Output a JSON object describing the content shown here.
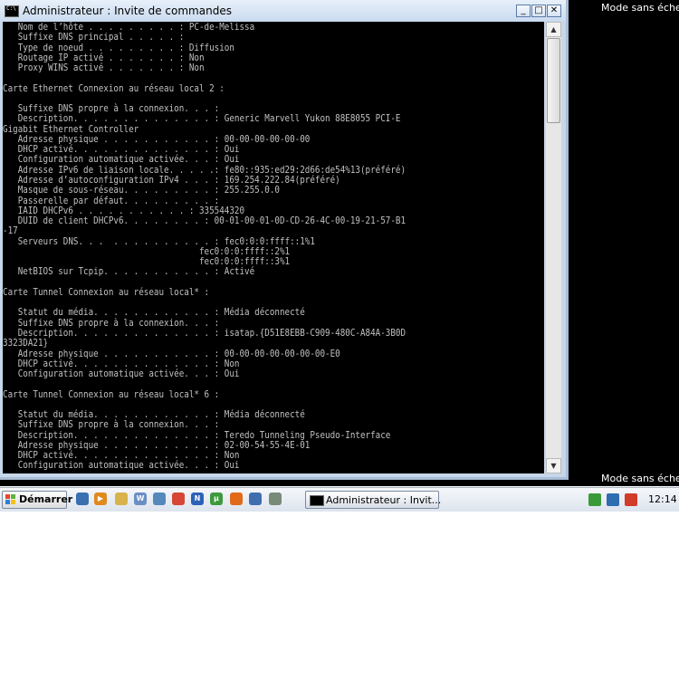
{
  "background": {
    "label_top": "Mode sans échec",
    "label_bottom": "Mode sans échec"
  },
  "window": {
    "title": "Administrateur : Invite de commandes",
    "buttons": {
      "minimize": "_",
      "maximize": "□",
      "close": "✕"
    }
  },
  "console": {
    "lines": [
      "   Nom de l’hôte . . . . . . . . . : PC-de-Melissa",
      "   Suffixe DNS principal . . . . . :",
      "   Type de noeud . . . . . . . . . : Diffusion",
      "   Routage IP activé . . . . . . . : Non",
      "   Proxy WINS activé . . . . . . . : Non",
      "",
      "Carte Ethernet Connexion au réseau local 2 :",
      "",
      "   Suffixe DNS propre à la connexion. . . :",
      "   Description. . . . . . . . . . . . . . : Generic Marvell Yukon 88E8055 PCI-E",
      "Gigabit Ethernet Controller",
      "   Adresse physique . . . . . . . . . . . : 00-00-00-00-00-00",
      "   DHCP activé. . . . . . . . . . . . . . : Oui",
      "   Configuration automatique activée. . . : Oui",
      "   Adresse IPv6 de liaison locale. . . . .: fe80::935:ed29:2d66:de54%13(préféré)",
      "   Adresse d’autoconfiguration IPv4 . . . : 169.254.222.84(préféré)",
      "   Masque de sous-réseau. . . . . . . . . : 255.255.0.0",
      "   Passerelle par défaut. . . . . . . . . :",
      "   IAID DHCPv6 . . . . . . . . . . . : 335544320",
      "   DUID de client DHCPv6. . . . . . . . : 00-01-00-01-0D-CD-26-4C-00-19-21-57-B1",
      "-17",
      "   Serveurs DNS. . .  . . . . . . . . . . : fec0:0:0:ffff::1%1",
      "                                       fec0:0:0:ffff::2%1",
      "                                       fec0:0:0:ffff::3%1",
      "   NetBIOS sur Tcpip. . . . . . . . . . . : Activé",
      "",
      "Carte Tunnel Connexion au réseau local* :",
      "",
      "   Statut du média. . . . . . . . . . . . : Média déconnecté",
      "   Suffixe DNS propre à la connexion. . . :",
      "   Description. . . . . . . . . . . . . . : isatap.{D51E8EBB-C909-480C-A84A-3B0D",
      "3323DA21}",
      "   Adresse physique . . . . . . . . . . . : 00-00-00-00-00-00-00-E0",
      "   DHCP activé. . . . . . . . . . . . . . : Non",
      "   Configuration automatique activée. . . : Oui",
      "",
      "Carte Tunnel Connexion au réseau local* 6 :",
      "",
      "   Statut du média. . . . . . . . . . . . : Média déconnecté",
      "   Suffixe DNS propre à la connexion. . . :",
      "   Description. . . . . . . . . . . . . . : Teredo Tunneling Pseudo-Interface",
      "   Adresse physique . . . . . . . . . . . : 02-00-54-55-4E-01",
      "   DHCP activé. . . . . . . . . . . . . . : Non",
      "   Configuration automatique activée. . . : Oui"
    ]
  },
  "taskbar": {
    "start_label": "Démarrer",
    "quicklaunch": [
      {
        "name": "show-desktop-icon",
        "color": "#3a6fb0",
        "glyph": ""
      },
      {
        "name": "media-player-icon",
        "color": "#e08a1e",
        "glyph": "▶"
      },
      {
        "name": "explorer-folder-icon",
        "color": "#d8b24a",
        "glyph": ""
      },
      {
        "name": "wordpad-icon",
        "color": "#6b8fc4",
        "glyph": "W"
      },
      {
        "name": "globe-icon",
        "color": "#5588bb",
        "glyph": ""
      },
      {
        "name": "chrome-icon",
        "color": "#d64535",
        "glyph": ""
      },
      {
        "name": "onenote-icon",
        "color": "#2b62b8",
        "glyph": "N"
      },
      {
        "name": "utorrent-icon",
        "color": "#3c9a3c",
        "glyph": "µ"
      },
      {
        "name": "firefox-icon",
        "color": "#e06a1a",
        "glyph": ""
      },
      {
        "name": "thunderbird-icon",
        "color": "#3f6fae",
        "glyph": ""
      },
      {
        "name": "tool-icon",
        "color": "#7a8a7a",
        "glyph": ""
      }
    ],
    "task_button_label": "Administrateur : Invit...",
    "clock": "12:14",
    "tray": [
      {
        "name": "safety-icon",
        "color": "#3a9a3a"
      },
      {
        "name": "network-icon",
        "color": "#2f6cb0"
      },
      {
        "name": "volume-muted-icon",
        "color": "#d23a2a"
      }
    ]
  }
}
